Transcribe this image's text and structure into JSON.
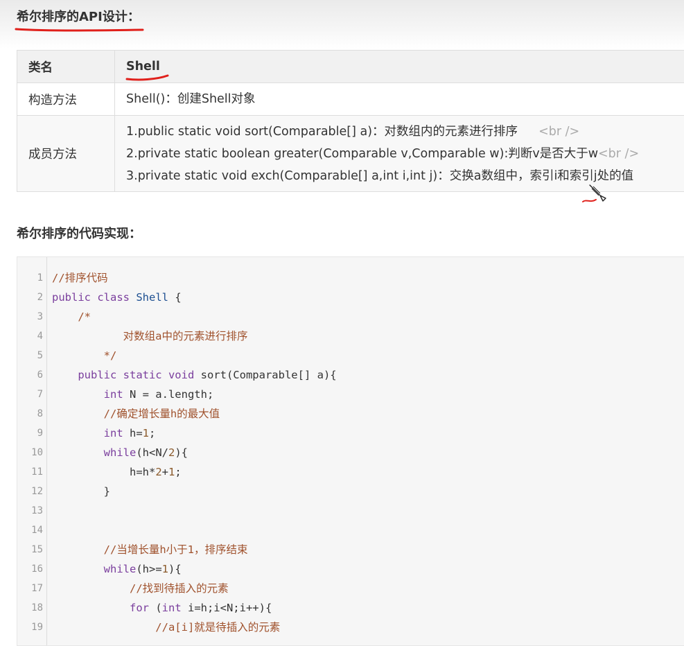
{
  "api_heading": "希尔排序的API设计：",
  "table": {
    "header": [
      "类名",
      "Shell"
    ],
    "rows": [
      {
        "label": "构造方法",
        "lines": [
          {
            "text": "Shell()：创建Shell对象",
            "br": ""
          }
        ]
      },
      {
        "label": "成员方法",
        "lines": [
          {
            "text": "1.public static void sort(Comparable[] a)：对数组内的元素进行排序",
            "br": "<br />"
          },
          {
            "text": "2.private static boolean greater(Comparable v,Comparable w):判断v是否大于w",
            "br": "<br />"
          },
          {
            "text": "3.private static void exch(Comparable[] a,int i,int j)：交换a数组中，索引i和索引j处的值",
            "br": ""
          }
        ]
      }
    ]
  },
  "code_heading": "希尔排序的代码实现：",
  "code": {
    "line_numbers": [
      "1",
      "2",
      "3",
      "4",
      "5",
      "6",
      "7",
      "8",
      "9",
      "10",
      "11",
      "12",
      "13",
      "14",
      "15",
      "16",
      "17",
      "18",
      "19"
    ],
    "lines": [
      [
        {
          "t": "//排序代码",
          "c": "cm"
        }
      ],
      [
        {
          "t": "public class ",
          "c": "kw"
        },
        {
          "t": "Shell",
          "c": "cls"
        },
        {
          "t": " {",
          "c": ""
        }
      ],
      [
        {
          "t": "    /*",
          "c": "cm"
        }
      ],
      [
        {
          "t": "           对数组a中的元素进行排序",
          "c": "cm"
        }
      ],
      [
        {
          "t": "        */",
          "c": "cm"
        }
      ],
      [
        {
          "t": "    public static void ",
          "c": "kw"
        },
        {
          "t": "sort(Comparable[] a){",
          "c": ""
        }
      ],
      [
        {
          "t": "        int ",
          "c": "kw"
        },
        {
          "t": "N = a.length;",
          "c": ""
        }
      ],
      [
        {
          "t": "        //确定增长量h的最大值",
          "c": "cm"
        }
      ],
      [
        {
          "t": "        int ",
          "c": "kw"
        },
        {
          "t": "h=",
          "c": ""
        },
        {
          "t": "1",
          "c": "nm"
        },
        {
          "t": ";",
          "c": ""
        }
      ],
      [
        {
          "t": "        while",
          "c": "kw"
        },
        {
          "t": "(h<N/",
          "c": ""
        },
        {
          "t": "2",
          "c": "nm"
        },
        {
          "t": "){",
          "c": ""
        }
      ],
      [
        {
          "t": "            h=h*",
          "c": ""
        },
        {
          "t": "2",
          "c": "nm"
        },
        {
          "t": "+",
          "c": ""
        },
        {
          "t": "1",
          "c": "nm"
        },
        {
          "t": ";",
          "c": ""
        }
      ],
      [
        {
          "t": "        }",
          "c": ""
        }
      ],
      [],
      [],
      [
        {
          "t": "        //当增长量h小于1，排序结束",
          "c": "cm"
        }
      ],
      [
        {
          "t": "        while",
          "c": "kw"
        },
        {
          "t": "(h>=",
          "c": ""
        },
        {
          "t": "1",
          "c": "nm"
        },
        {
          "t": "){",
          "c": ""
        }
      ],
      [
        {
          "t": "            //找到待插入的元素",
          "c": "cm"
        }
      ],
      [
        {
          "t": "            for ",
          "c": "kw"
        },
        {
          "t": "(",
          "c": ""
        },
        {
          "t": "int ",
          "c": "kw"
        },
        {
          "t": "i=h;i<N;i++){",
          "c": ""
        }
      ],
      [
        {
          "t": "                //a[i]就是待插入的元素",
          "c": "cm"
        }
      ]
    ]
  },
  "colors": {
    "keyword": "#7a3e9d",
    "comment": "#a0522d",
    "class_name": "#1d4f91",
    "number": "#8b5a2b",
    "annotation_red": "#e0201b"
  }
}
